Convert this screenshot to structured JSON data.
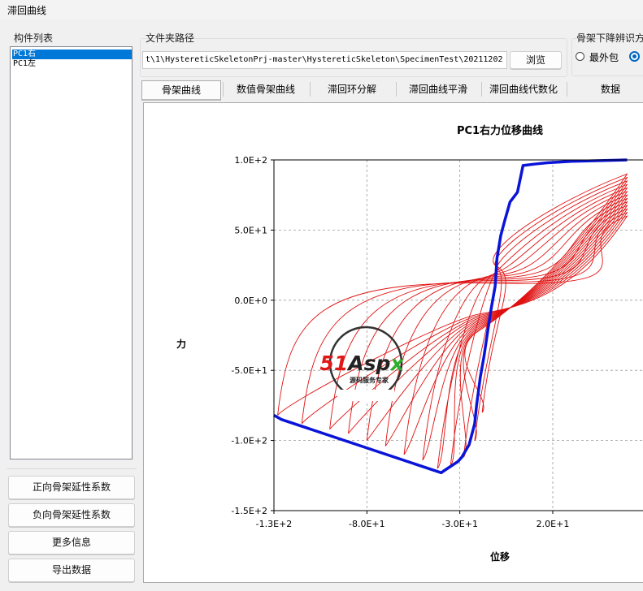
{
  "window": {
    "title": "滞回曲线"
  },
  "component_list": {
    "label": "构件列表",
    "items": [
      {
        "label": "PC1右",
        "selected": true
      },
      {
        "label": "PC1左",
        "selected": false
      }
    ]
  },
  "buttons": {
    "pos_ductility": "正向骨架延性系数",
    "neg_ductility": "负向骨架延性系数",
    "more_info": "更多信息",
    "export": "导出数据"
  },
  "folder": {
    "label": "文件夹路径",
    "path": "t\\1\\HystereticSkeletonPrj-master\\HystereticSkeleton\\SpecimenTest\\20211202",
    "browse": "浏览"
  },
  "skeleton_option": {
    "label": "骨架下降辨识方",
    "option1": "最外包",
    "selected_second": true
  },
  "tabs": [
    {
      "label": "骨架曲线",
      "active": true
    },
    {
      "label": "数值骨架曲线",
      "active": false
    },
    {
      "label": "滞回环分解",
      "active": false
    },
    {
      "label": "滞回曲线平滑",
      "active": false
    },
    {
      "label": "滞回曲线代数化",
      "active": false
    },
    {
      "label": "数据",
      "active": false
    }
  ],
  "watermark": {
    "brand": "51Aspx",
    "tagline": "源码服务专家"
  },
  "chart_data": {
    "type": "line",
    "title": "PC1右力位移曲线",
    "xlabel": "位移",
    "ylabel": "力",
    "xlim": [
      -130,
      60
    ],
    "ylim": [
      -150,
      100
    ],
    "x_ticks": [
      "-1.3E+2",
      "-8.0E+1",
      "-3.0E+1",
      "2.0E+1"
    ],
    "x_tick_values": [
      -130,
      -80,
      -30,
      20
    ],
    "y_ticks": [
      "1.0E+2",
      "5.0E+1",
      "0.0E+0",
      "-5.0E+1",
      "-1.0E+2",
      "-1.5E+2"
    ],
    "y_tick_values": [
      100,
      50,
      0,
      -50,
      -100,
      -150
    ],
    "grid": true,
    "colors": {
      "skeleton": "#0a14d8",
      "hysteresis": "#e01010"
    },
    "series": [
      {
        "role": "skeleton",
        "points": [
          [
            -130,
            -82
          ],
          [
            -126,
            -85
          ],
          [
            -40,
            -123
          ],
          [
            -39,
            -122
          ],
          [
            -31,
            -115
          ],
          [
            -29,
            -112
          ],
          [
            -25,
            -103
          ],
          [
            -22,
            -88
          ],
          [
            -21,
            -75
          ],
          [
            -19,
            -55
          ],
          [
            -17,
            -40
          ],
          [
            -15,
            -22
          ],
          [
            -13,
            -5
          ],
          [
            -11,
            10
          ],
          [
            -10,
            30
          ],
          [
            -8,
            46
          ],
          [
            -6,
            56
          ],
          [
            -3,
            70
          ],
          [
            1,
            77
          ],
          [
            4,
            96
          ],
          [
            10,
            97
          ],
          [
            17,
            98
          ],
          [
            30,
            99
          ],
          [
            60,
            100
          ]
        ]
      }
    ]
  }
}
